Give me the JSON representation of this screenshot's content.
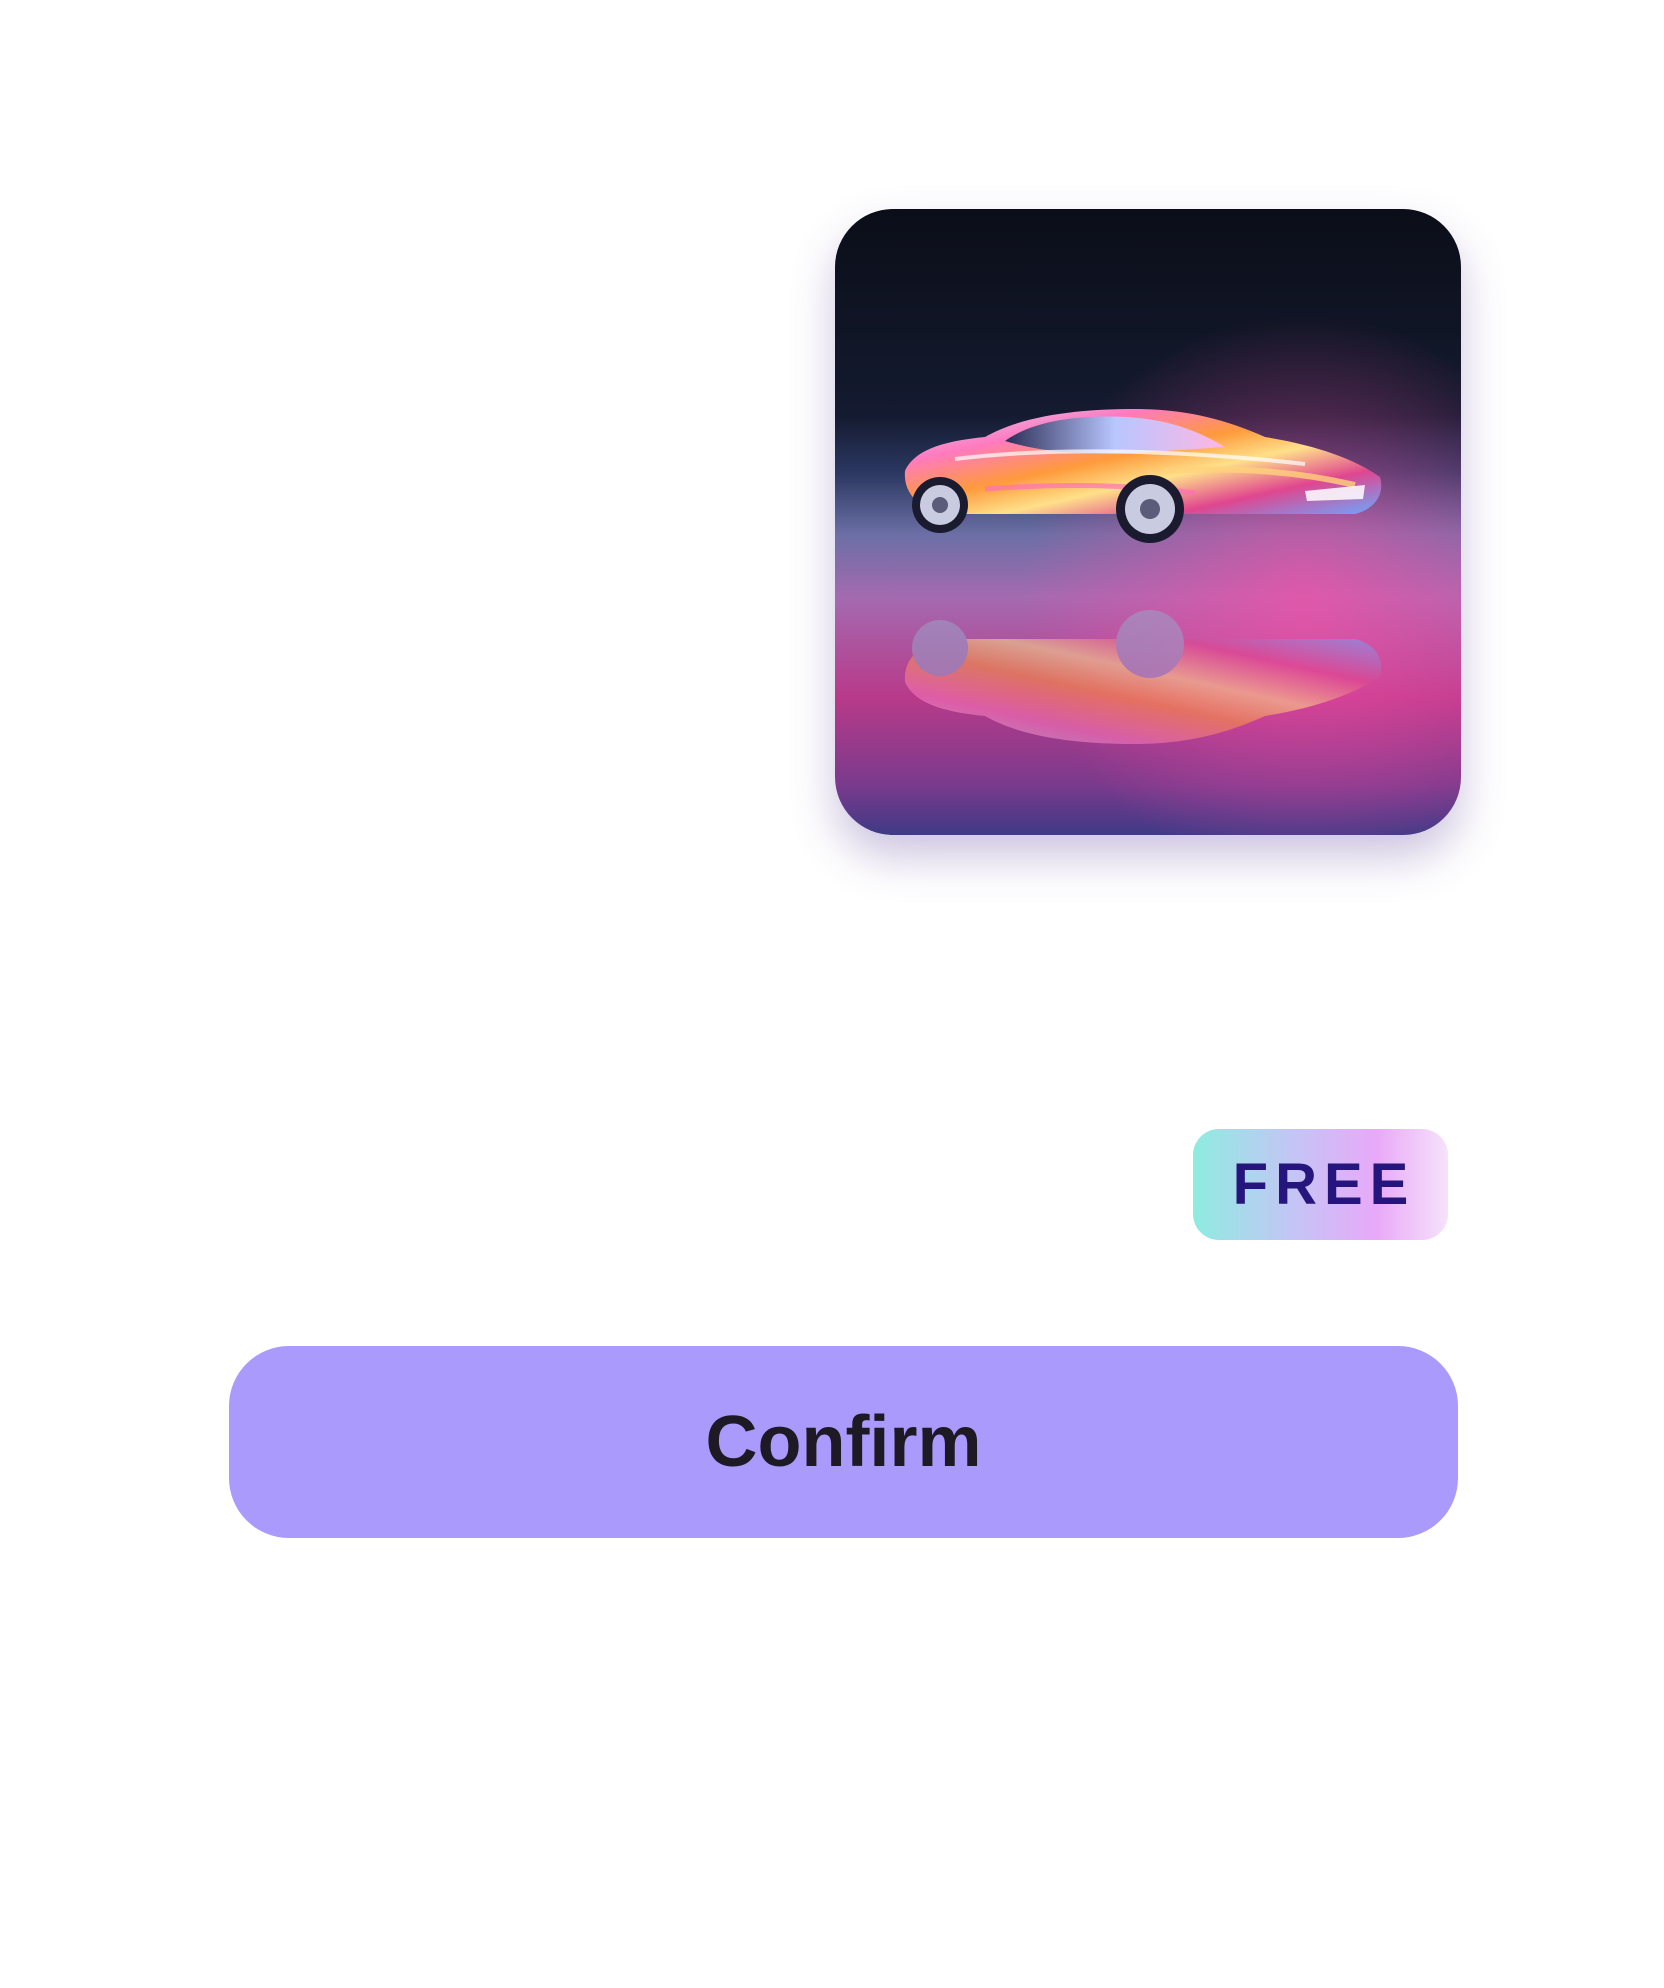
{
  "artwork": {
    "image_description_icon": "sports-car-artwork-icon",
    "colors": {
      "background_top": "#0c0f1a",
      "background_mid": "#19203a",
      "floor_pink": "#c0307f",
      "floor_purple": "#553c86"
    }
  },
  "badge": {
    "label": "FREE",
    "text_color": "#26157c",
    "gradient": [
      "#8eece0",
      "#c5c4f6",
      "#e8a9f8",
      "#f6e2fb"
    ]
  },
  "actions": {
    "confirm_label": "Confirm",
    "confirm_color": "#a99afb"
  }
}
